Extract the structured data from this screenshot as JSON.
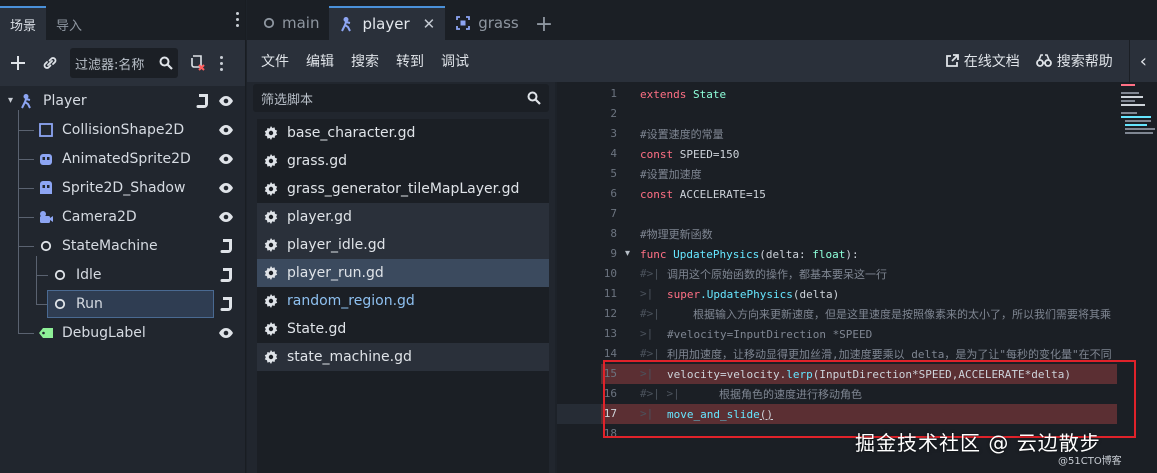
{
  "left_panel": {
    "tabs": [
      "场景",
      "导入"
    ],
    "filter_placeholder": "过滤器:名称",
    "tree": [
      {
        "label": "Player",
        "icon": "character-body-icon"
      },
      {
        "label": "CollisionShape2D",
        "icon": "collision-shape-icon"
      },
      {
        "label": "AnimatedSprite2D",
        "icon": "animated-sprite-icon"
      },
      {
        "label": "Sprite2D_Shadow",
        "icon": "sprite-icon"
      },
      {
        "label": "Camera2D",
        "icon": "camera-icon"
      },
      {
        "label": "StateMachine",
        "icon": "node-circle-icon"
      },
      {
        "label": "Idle",
        "icon": "node-circle-icon"
      },
      {
        "label": "Run",
        "icon": "node-circle-icon"
      },
      {
        "label": "DebugLabel",
        "icon": "label-icon"
      }
    ]
  },
  "doc_tabs": [
    {
      "label": "main"
    },
    {
      "label": "player"
    },
    {
      "label": "grass"
    }
  ],
  "menubar": {
    "items": [
      "文件",
      "编辑",
      "搜索",
      "转到",
      "调试"
    ],
    "online_docs": "在线文档",
    "search_help": "搜索帮助"
  },
  "script_panel": {
    "filter_placeholder": "筛选脚本",
    "scripts": [
      "base_character.gd",
      "grass.gd",
      "grass_generator_tileMapLayer.gd",
      "player.gd",
      "player_idle.gd",
      "player_run.gd",
      "random_region.gd",
      "State.gd",
      "state_machine.gd"
    ]
  },
  "editor": {
    "line_numbers": [
      "1",
      "2",
      "3",
      "4",
      "5",
      "6",
      "7",
      "8",
      "9",
      "10",
      "11",
      "12",
      "13",
      "14",
      "15",
      "16",
      "17",
      "18"
    ],
    "lines": {
      "l1_kw": "extends",
      "l1_ty": "State",
      "l3": "#设置速度的常量",
      "l4_kw": "const",
      "l4_rest": "SPEED=150",
      "l5": "#设置加速度",
      "l6_kw": "const",
      "l6_rest": "ACCELERATE=15",
      "l8": "#物理更新函数",
      "l9_kw": "func",
      "l9_fn": "UpdatePhysics",
      "l9_a": "(delta: ",
      "l9_ty": "float",
      "l9_b": "):",
      "l10": "调用这个原始函数的操作，都基本要呆这一行",
      "l11_kw": "super",
      "l11_fn": ".UpdatePhysics",
      "l11_rest": "(delta)",
      "l12": "根据输入方向来更新速度，但是这里速度是按照像素来的太小了，所以我们需要将其乘",
      "l13": "#velocity=InputDirection *SPEED",
      "l14": "利用加速度，让移动显得更加丝滑,加速度要乘以 delta，是为了让\"每秒的变化量\"在不同",
      "l15_a": "velocity=velocity.",
      "l15_fn": "lerp",
      "l15_b": "(InputDirection*SPEED,ACCELERATE*delta)",
      "l16": "根据角色的速度进行移动角色",
      "l17_fn": "move_and_slide",
      "l17_b": "()"
    }
  },
  "watermark": "掘金技术社区 @ 云边散步",
  "watermark_small": "@51CTO博客",
  "colors": {
    "accent": "#4a90d9",
    "highlight_line": "#5b2f33",
    "red_box": "#e0222a"
  }
}
